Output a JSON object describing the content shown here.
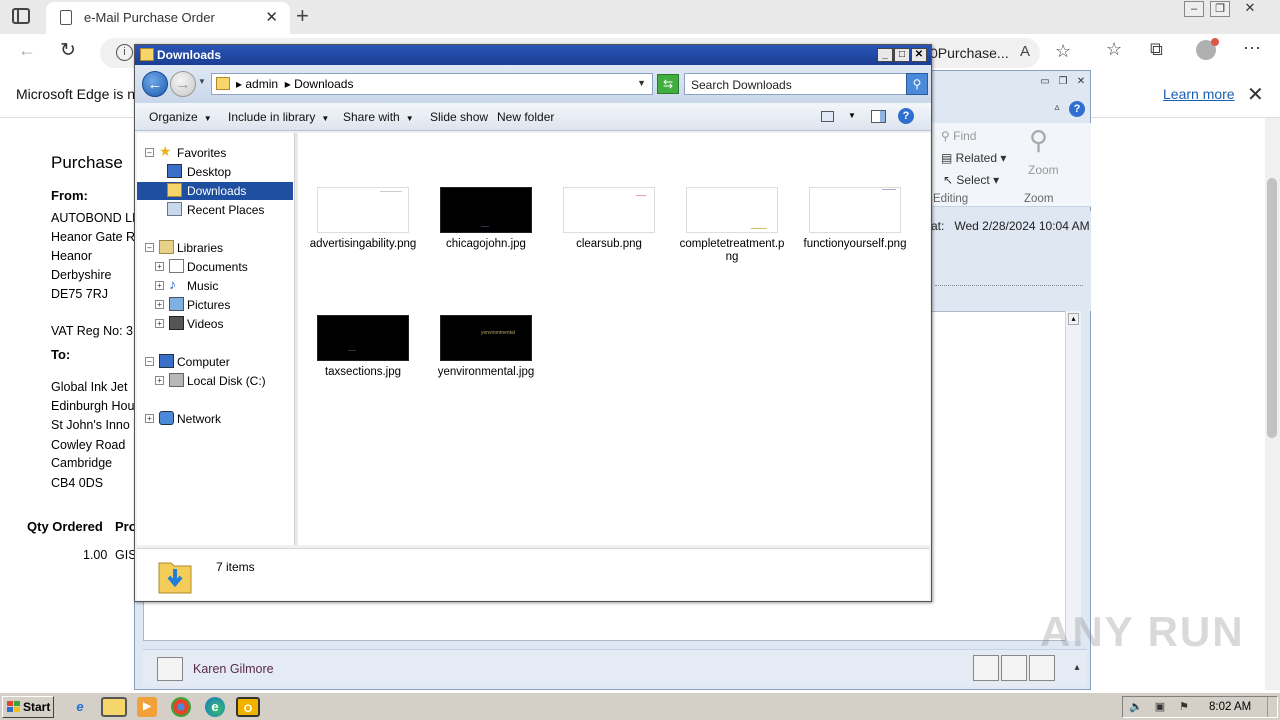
{
  "browser": {
    "tab_title": "e-Mail Purchase Order",
    "url_fragment": "0Purchase...",
    "info_text": "Microsoft Edge is no",
    "learn_more": "Learn more"
  },
  "purchase_order": {
    "title": "Purchase",
    "from_label": "From:",
    "from_lines": [
      "AUTOBOND LIM",
      "Heanor Gate R",
      "Heanor",
      "Derbyshire",
      "DE75 7RJ"
    ],
    "vat_label": "VAT Reg No: 3",
    "to_label": "To:",
    "to_lines": [
      "Global Ink Jet",
      "Edinburgh Hou",
      "St John's Inno",
      "Cowley Road",
      "Cambridge",
      "CB4 0DS"
    ],
    "col_qty": "Qty Ordered",
    "col_pr": "Pro",
    "row_qty": "1.00",
    "row_code": "GIS"
  },
  "outlook": {
    "find": "Find",
    "related": "Related",
    "select": "Select",
    "editing_label": "Editing",
    "zoom": "Zoom",
    "zoom_group": "Zoom",
    "sent_prefix": "at:",
    "sent_date": "Wed 2/28/2024 10:04 AM",
    "person_name": "Karen Gilmore"
  },
  "explorer": {
    "title": "Downloads",
    "breadcrumb": [
      "admin",
      "Downloads"
    ],
    "search_placeholder": "Search Downloads",
    "commands": {
      "organize": "Organize",
      "include_in_library": "Include in library",
      "share_with": "Share with",
      "slide_show": "Slide show",
      "new_folder": "New folder"
    },
    "nav": {
      "favorites": "Favorites",
      "desktop": "Desktop",
      "downloads": "Downloads",
      "recent_places": "Recent Places",
      "libraries": "Libraries",
      "documents": "Documents",
      "music": "Music",
      "pictures": "Pictures",
      "videos": "Videos",
      "computer": "Computer",
      "local_disk": "Local Disk (C:)",
      "network": "Network"
    },
    "files": [
      {
        "name": "advertisingability.png",
        "thumb": "light"
      },
      {
        "name": "chicagojohn.jpg",
        "thumb": "dark"
      },
      {
        "name": "clearsub.png",
        "thumb": "light"
      },
      {
        "name": "completetreatment.png",
        "thumb": "light"
      },
      {
        "name": "functionyourself.png",
        "thumb": "light"
      },
      {
        "name": "taxsections.jpg",
        "thumb": "dark"
      },
      {
        "name": "yenvironmental.jpg",
        "thumb": "dark"
      }
    ],
    "thumb_text_yenvironmental": "yenvironmental",
    "status_count": "7 items"
  },
  "taskbar": {
    "start_label": "Start",
    "clock": "8:02 AM"
  },
  "watermark": "ANY RUN",
  "colors": {
    "explorer_title_bar": "#1b3e94",
    "selection": "#1e4fa0",
    "taskbar": "#d4d0c8"
  }
}
